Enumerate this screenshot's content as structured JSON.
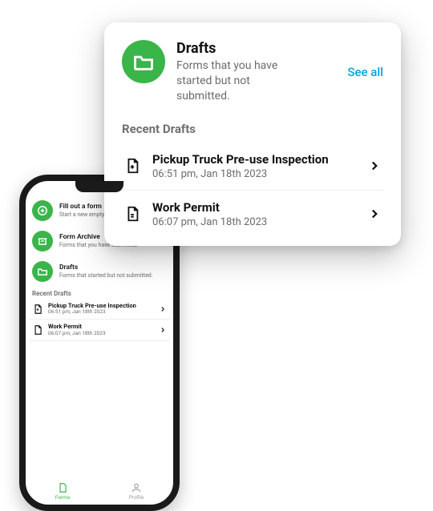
{
  "card": {
    "title": "Drafts",
    "subtitle": "Forms that you have started but not submitted.",
    "see_all": "See all",
    "section": "Recent Drafts",
    "items": [
      {
        "title": "Pickup Truck Pre-use Inspection",
        "time": "06:51 pm, Jan 18th 2023"
      },
      {
        "title": "Work Permit",
        "time": "06:07 pm, Jan 18th 2023"
      }
    ]
  },
  "phone": {
    "menu": [
      {
        "title": "Fill out a form",
        "subtitle": "Start a new empty form."
      },
      {
        "title": "Form Archive",
        "subtitle": "Forms that you have submitted."
      },
      {
        "title": "Drafts",
        "subtitle": "Forms that started but not submitted."
      }
    ],
    "section": "Recent Drafts",
    "items": [
      {
        "title": "Pickup Truck Pre-use Inspection",
        "time": "06:51 pm, Jan 18th 2023"
      },
      {
        "title": "Work Permit",
        "time": "06:07 pm, Jan 18th 2023"
      }
    ],
    "tabs": {
      "forms": "Forms",
      "profile": "Profile"
    }
  }
}
